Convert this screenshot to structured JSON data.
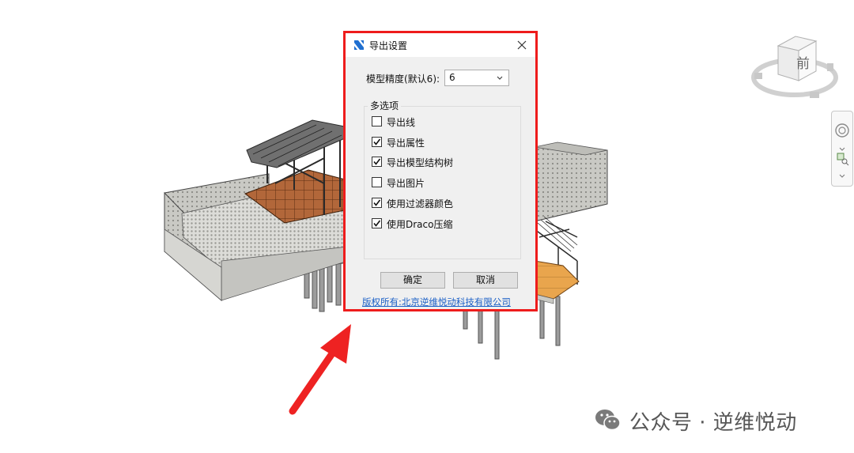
{
  "dialog": {
    "title": "导出设置",
    "close_icon": "close-icon",
    "precision_label": "模型精度(默认6):",
    "precision_value": "6",
    "options_group_title": "多选项",
    "options": [
      {
        "label": "导出线",
        "checked": false
      },
      {
        "label": "导出属性",
        "checked": true
      },
      {
        "label": "导出模型结构树",
        "checked": true
      },
      {
        "label": "导出图片",
        "checked": false
      },
      {
        "label": "使用过滤器颜色",
        "checked": true
      },
      {
        "label": "使用Draco压缩",
        "checked": true
      }
    ],
    "ok_label": "确定",
    "cancel_label": "取消",
    "copyright_link": "版权所有:北京逆维悦动科技有限公司"
  },
  "viewcube": {
    "face_label": "前"
  },
  "watermark": {
    "text": "公众号 · 逆维悦动"
  },
  "colors": {
    "highlight_border": "#ee1c1c",
    "link": "#1a5fc6",
    "dialog_bg": "#f0f0f0"
  }
}
